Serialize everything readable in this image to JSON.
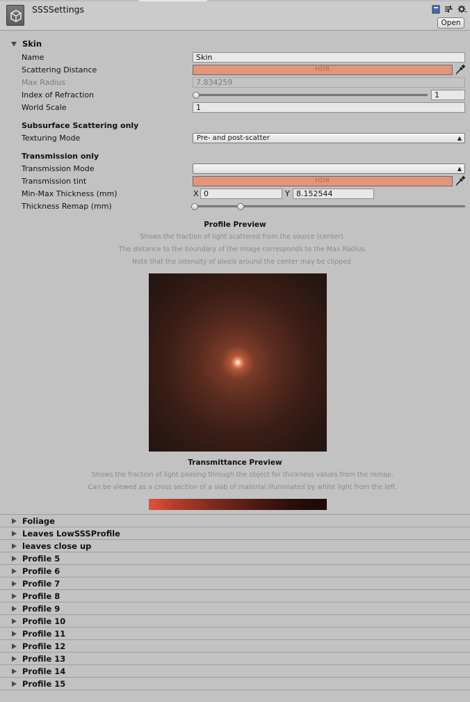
{
  "header": {
    "title": "SSSSettings",
    "open_label": "Open",
    "icons": [
      "help-book-icon",
      "preset-icon",
      "gear-menu-icon"
    ]
  },
  "skin": {
    "name": "Skin",
    "fields": {
      "name_label": "Name",
      "name_value": "Skin",
      "scattering_label": "Scattering Distance",
      "hdr_text": "HDR",
      "maxradius_label": "Max Radius",
      "maxradius_value": "7.834259",
      "ior_label": "Index of Refraction",
      "ior_value": "1",
      "ior_slider_fraction": 0.0,
      "worldscale_label": "World Scale",
      "worldscale_value": "1"
    },
    "sss_only": {
      "title": "Subsurface Scattering only",
      "texturing_label": "Texturing Mode",
      "texturing_value": "Pre- and post-scatter"
    },
    "transmission_only": {
      "title": "Transmission only",
      "mode_label": "Transmission Mode",
      "mode_value": "",
      "tint_label": "Transmission tint",
      "tint_hdr_text": "HDR",
      "thickness_label": "Min-Max Thickness (mm)",
      "x_label": "X",
      "x_value": "0",
      "y_label": "Y",
      "y_value": "8.152544",
      "remap_label": "Thickness Remap (mm)",
      "remap_min_fraction": 0.0,
      "remap_max_fraction": 0.17
    },
    "profile_preview": {
      "title": "Profile Preview",
      "lines": [
        "Shows the fraction of light scattered from the source (center).",
        "The distance to the boundary of the image corresponds to the Max Radius.",
        "Note that the intensity of pixels around the center may be clipped."
      ]
    },
    "transmittance_preview": {
      "title": "Transmittance Preview",
      "lines": [
        "Shows the fraction of light passing through the object for thickness values from the remap.",
        "Can be viewed as a cross section of a slab of material illuminated by white light from the left."
      ]
    }
  },
  "profiles": [
    "Foliage",
    "Leaves LowSSSProfile",
    "leaves close up",
    "Profile 5",
    "Profile 6",
    "Profile 7",
    "Profile 8",
    "Profile 9",
    "Profile 10",
    "Profile 11",
    "Profile 12",
    "Profile 13",
    "Profile 14",
    "Profile 15"
  ],
  "colors": {
    "scattering_color": "#e39579",
    "tint_color": "#e39579",
    "panel_bg": "#c2c2c2"
  }
}
